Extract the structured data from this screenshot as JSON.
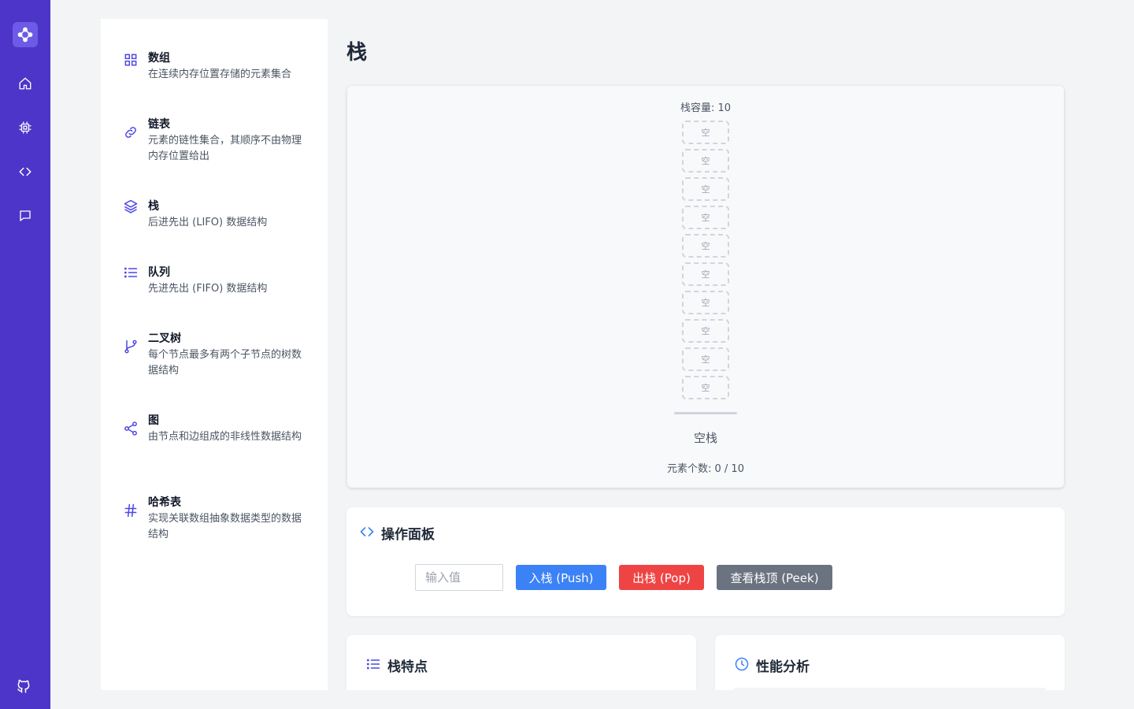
{
  "app": {
    "rail": {
      "logo_icon": "molecule-logo-icon",
      "items": [
        {
          "icon": "home-icon"
        },
        {
          "icon": "cpu-chip-icon"
        },
        {
          "icon": "code-brackets-icon"
        },
        {
          "icon": "chat-bubble-icon"
        }
      ],
      "bottom_icon": "github-icon"
    }
  },
  "sidebar": {
    "items": [
      {
        "title": "数组",
        "desc": "在连续内存位置存储的元素集合",
        "icon": "grid-icon"
      },
      {
        "title": "链表",
        "desc": "元素的链性集合，其顺序不由物理内存位置给出",
        "icon": "link-icon"
      },
      {
        "title": "栈",
        "desc": "后进先出 (LIFO) 数据结构",
        "icon": "layers-icon"
      },
      {
        "title": "队列",
        "desc": "先进先出 (FIFO) 数据结构",
        "icon": "list-icon"
      },
      {
        "title": "二叉树",
        "desc": "每个节点最多有两个子节点的树数据结构",
        "icon": "git-branch-icon"
      },
      {
        "title": "图",
        "desc": "由节点和边组成的非线性数据结构",
        "icon": "share-nodes-icon"
      },
      {
        "title": "哈希表",
        "desc": "实现关联数组抽象数据类型的数据结构",
        "icon": "hash-icon"
      }
    ]
  },
  "main": {
    "title": "栈",
    "visualization": {
      "capacity_label": "栈容量: 10",
      "slots": [
        "空",
        "空",
        "空",
        "空",
        "空",
        "空",
        "空",
        "空",
        "空",
        "空"
      ],
      "empty_label": "空栈",
      "count_label": "元素个数: 0 / 10"
    },
    "operations": {
      "title": "操作面板",
      "icon": "code-brackets-icon",
      "input_placeholder": "输入值",
      "push_label": "入栈 (Push)",
      "pop_label": "出栈 (Pop)",
      "peek_label": "查看栈顶 (Peek)",
      "colors": {
        "push": "#3b82f6",
        "pop": "#ef4444",
        "peek": "#6b7280"
      }
    },
    "features": {
      "title": "栈特点",
      "icon": "list-icon"
    },
    "performance": {
      "title": "性能分析",
      "icon": "clock-icon"
    }
  },
  "colors": {
    "accent": "#4c35c8",
    "icon": "#4f46e5"
  }
}
